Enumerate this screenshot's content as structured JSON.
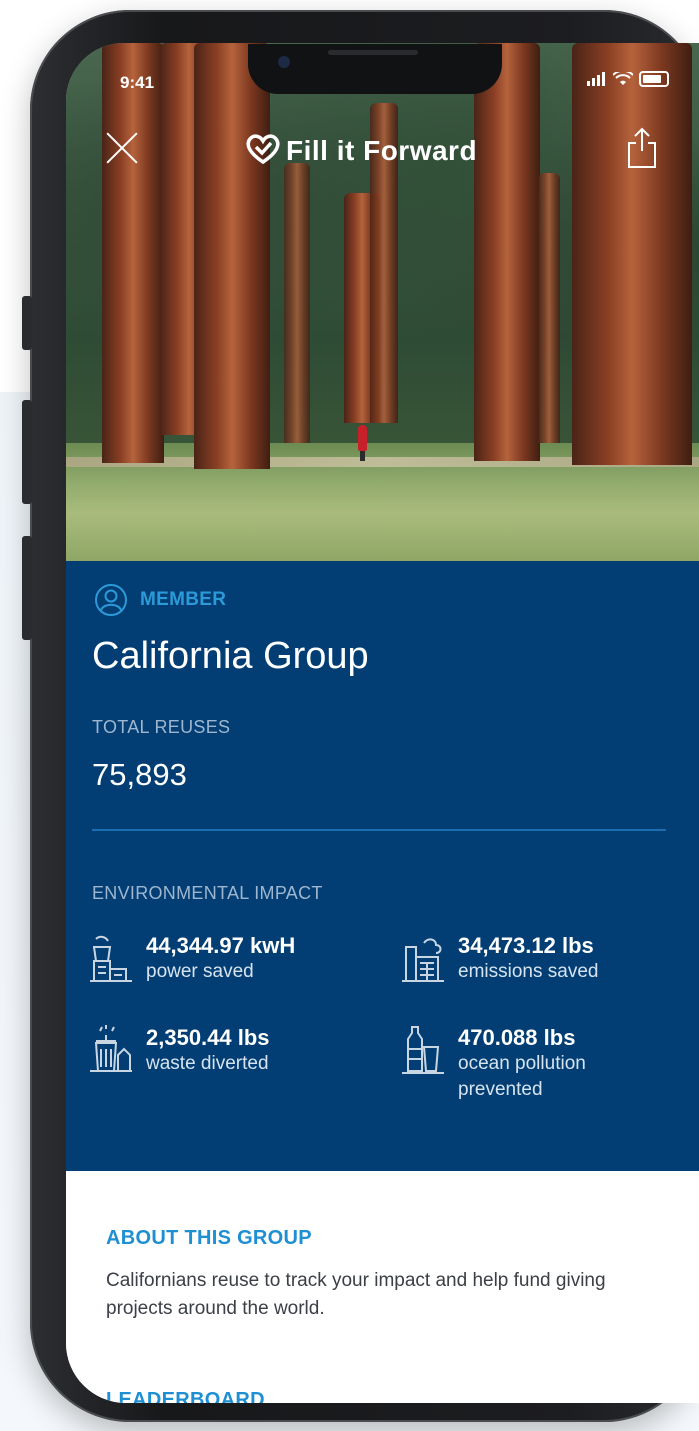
{
  "status_bar": {
    "time": "9:41"
  },
  "header": {
    "brand_name": "Fill it Forward",
    "brand_icon": "heart-check-icon",
    "close_icon": "close-icon",
    "share_icon": "share-icon"
  },
  "colors": {
    "panel_blue": "#023e73",
    "accent_blue": "#2c9ad8",
    "muted_label": "#9eb6cf"
  },
  "group": {
    "role_label": "MEMBER",
    "role_icon": "user-circle-icon",
    "name": "California Group",
    "total_reuses_label": "TOTAL REUSES",
    "total_reuses_value": "75,893"
  },
  "impact": {
    "label": "ENVIRONMENTAL IMPACT",
    "metrics": [
      {
        "icon": "power-plant-icon",
        "value": "44,344.97 kwH",
        "description": "power saved"
      },
      {
        "icon": "factory-emissions-icon",
        "value": "34,473.12 lbs",
        "description": "emissions saved"
      },
      {
        "icon": "trash-bin-icon",
        "value": "2,350.44 lbs",
        "description": "waste diverted"
      },
      {
        "icon": "bottle-cup-icon",
        "value": "470.088 lbs",
        "description": "ocean pollution prevented"
      }
    ]
  },
  "about": {
    "title": "ABOUT THIS GROUP",
    "text": "Californians reuse to track your impact and help fund giving projects around the world."
  },
  "leaderboard": {
    "title": "LEADERBOARD"
  }
}
